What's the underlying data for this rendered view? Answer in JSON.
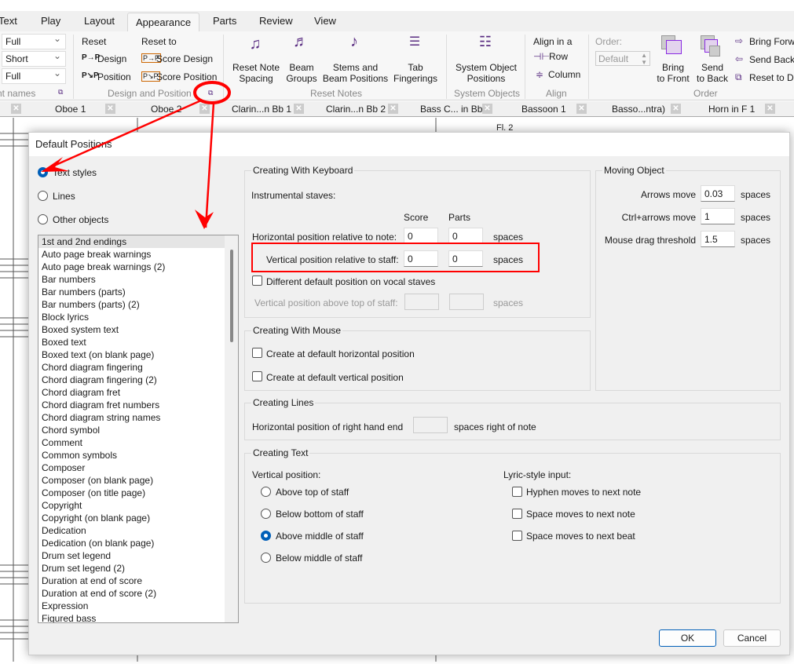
{
  "ribbon_tabs": [
    "Text",
    "Play",
    "Layout",
    "Appearance",
    "Parts",
    "Review",
    "View"
  ],
  "active_tab": "Appearance",
  "ribbon": {
    "names_combos": [
      "Full",
      "Short",
      "Full"
    ],
    "names_group": "nt names",
    "reset": "Reset",
    "design": "Design",
    "position": "Position",
    "reset_to": "Reset to",
    "score_design": "Score Design",
    "score_position": "Score Position",
    "design_group": "Design and Position",
    "reset_note_spacing": [
      "Reset Note",
      "Spacing"
    ],
    "beam_groups": [
      "Beam",
      "Groups"
    ],
    "stems_beam": [
      "Stems and",
      "Beam Positions"
    ],
    "tab_fingerings": [
      "Tab",
      "Fingerings"
    ],
    "reset_notes_group": "Reset Notes",
    "system_object_positions": [
      "System Object",
      "Positions"
    ],
    "system_objects_group": "System Objects",
    "align_in_a": "Align in a",
    "row": "Row",
    "column": "Column",
    "align_group": "Align",
    "order_label": "Order:",
    "order_value": "Default",
    "bring_to_front": [
      "Bring",
      "to Front"
    ],
    "send_to_back": [
      "Send",
      "to Back"
    ],
    "bring_forward": "Bring Forw",
    "send_backward": "Send Backw",
    "reset_to_default": "Reset to De",
    "order_group": "Order"
  },
  "score_tabs": [
    "Oboe  1",
    "Oboe 2",
    "Clarin...n Bb 1",
    "Clarin...n Bb 2",
    "Bass C... in Bb",
    "Bassoon 1",
    "Basso...ntra)",
    "Horn in F 1"
  ],
  "score_label": "Fl. 2",
  "dialog": {
    "title": "Default Positions",
    "categories": [
      {
        "label": "Text styles",
        "selected": true
      },
      {
        "label": "Lines",
        "selected": false
      },
      {
        "label": "Other objects",
        "selected": false
      }
    ],
    "items": [
      "1st and 2nd endings",
      "Auto page break warnings",
      "Auto page break warnings (2)",
      "Bar numbers",
      "Bar numbers (parts)",
      "Bar numbers (parts) (2)",
      "Block lyrics",
      "Boxed system text",
      "Boxed text",
      "Boxed text (on blank page)",
      "Chord diagram fingering",
      "Chord diagram fingering (2)",
      "Chord diagram fret",
      "Chord diagram fret numbers",
      "Chord diagram string names",
      "Chord symbol",
      "Comment",
      "Common symbols",
      "Composer",
      "Composer (on blank page)",
      "Composer (on title page)",
      "Copyright",
      "Copyright (on blank page)",
      "Dedication",
      "Dedication (on blank page)",
      "Drum set legend",
      "Drum set legend (2)",
      "Duration at end of score",
      "Duration at end of score (2)",
      "Expression",
      "Figured bass"
    ],
    "keyboard": {
      "title": "Creating With Keyboard",
      "instrumental": "Instrumental staves:",
      "score": "Score",
      "parts": "Parts",
      "horiz_label": "Horizontal position relative to note:",
      "horiz_score": "0",
      "horiz_parts": "0",
      "vert_label": "Vertical position relative to staff:",
      "vert_score": "0",
      "vert_parts": "0",
      "spaces": "spaces",
      "vocal_check": "Different default position on vocal staves",
      "vocal_label": "Vertical position above top of staff:",
      "vocal_score": "",
      "vocal_parts": ""
    },
    "mouse": {
      "title": "Creating With Mouse",
      "horiz": "Create at default horizontal position",
      "vert": "Create at default vertical position"
    },
    "moving": {
      "title": "Moving Object",
      "arrows": "Arrows move",
      "arrows_val": "0.03",
      "ctrl": "Ctrl+arrows move",
      "ctrl_val": "1",
      "drag": "Mouse drag threshold",
      "drag_val": "1.5",
      "spaces": "spaces"
    },
    "lines": {
      "title": "Creating Lines",
      "label": "Horizontal position of right hand end",
      "value": "",
      "suffix": "spaces right of note"
    },
    "text": {
      "title": "Creating Text",
      "vertical": "Vertical position:",
      "options": [
        {
          "label": "Above top of staff",
          "selected": false
        },
        {
          "label": "Below bottom of staff",
          "selected": false
        },
        {
          "label": "Above middle of staff",
          "selected": true
        },
        {
          "label": "Below middle of staff",
          "selected": false
        }
      ],
      "lyric": "Lyric-style input:",
      "lyric_opts": [
        "Hyphen moves to next note",
        "Space moves to next note",
        "Space moves to next beat"
      ]
    },
    "ok": "OK",
    "cancel": "Cancel"
  },
  "colors": {
    "accent": "#005fb8",
    "annotation": "#ff0000",
    "ribbon_icon": "#5a2d82"
  }
}
